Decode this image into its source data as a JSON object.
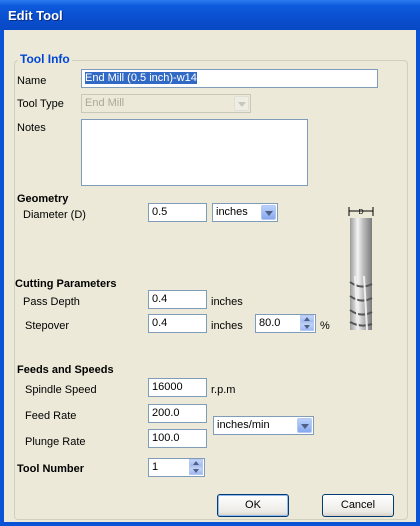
{
  "window": {
    "title": "Edit Tool"
  },
  "tool_info": {
    "legend": "Tool Info",
    "name_label": "Name",
    "name_value": "End Mill (0.5 inch)-w14",
    "type_label": "Tool Type",
    "type_value": "End Mill",
    "notes_label": "Notes",
    "notes_value": ""
  },
  "geometry": {
    "heading": "Geometry",
    "diameter_label": "Diameter (D)",
    "diameter_value": "0.5",
    "units_value": "inches",
    "illustration_label": "D"
  },
  "cutting": {
    "heading": "Cutting Parameters",
    "pass_depth_label": "Pass Depth",
    "pass_depth_value": "0.4",
    "pass_depth_units": "inches",
    "stepover_label": "Stepover",
    "stepover_value": "0.4",
    "stepover_units": "inches",
    "stepover_percent_value": "80.0",
    "percent_sign": "%"
  },
  "feeds": {
    "heading": "Feeds and Speeds",
    "spindle_label": "Spindle Speed",
    "spindle_value": "16000",
    "spindle_units": "r.p.m",
    "feed_label": "Feed Rate",
    "feed_value": "200.0",
    "plunge_label": "Plunge Rate",
    "plunge_value": "100.0",
    "rate_units_value": "inches/min"
  },
  "tool_number": {
    "heading": "Tool Number",
    "value": "1"
  },
  "buttons": {
    "ok": "OK",
    "cancel": "Cancel"
  }
}
